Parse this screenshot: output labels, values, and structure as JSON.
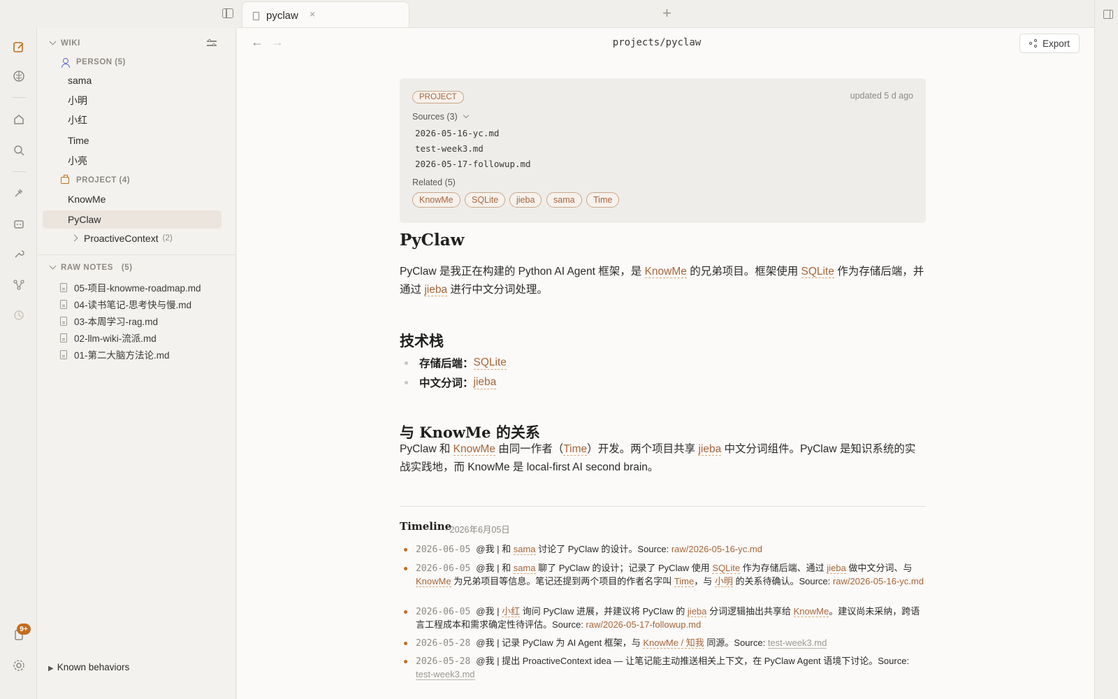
{
  "tab": {
    "title": "pyclaw",
    "close": "×",
    "new": "+"
  },
  "sidebar": {
    "wiki_label": "WIKI",
    "person_header": "PERSON (5)",
    "persons": [
      "sama",
      "小明",
      "小红",
      "Time",
      "小亮"
    ],
    "project_header": "PROJECT (4)",
    "projects": [
      "KnowMe",
      "PyClaw"
    ],
    "proactive": {
      "label": "ProactiveContext",
      "count": "(2)"
    },
    "raw_notes_label": "RAW NOTES",
    "raw_notes_count": "(5)",
    "raw_files": [
      "05-项目-knowme-roadmap.md",
      "04-读书笔记-思考快与慢.md",
      "03-本周学习-rag.md",
      "02-llm-wiki-流派.md",
      "01-第二大脑方法论.md"
    ],
    "known_behaviors": "Known behaviors"
  },
  "rail": {
    "badge": "9+"
  },
  "main": {
    "breadcrumb": "projects/pyclaw",
    "export_label": "Export",
    "meta": {
      "type_pill": "PROJECT",
      "updated": "updated 5 d ago",
      "sources_label": "Sources (3)",
      "sources": [
        "2026-05-16-yc.md",
        "test-week3.md",
        "2026-05-17-followup.md"
      ],
      "related_label": "Related (5)",
      "related": [
        "KnowMe",
        "SQLite",
        "jieba",
        "sama",
        "Time"
      ]
    },
    "title": "PyClaw",
    "intro": {
      "t1": "PyClaw 是我正在构建的 Python AI Agent 框架，是 ",
      "l1": "KnowMe",
      "t2": " 的兄弟项目。框架使用 ",
      "l2": "SQLite",
      "t3": " 作为存储后端，并通过 ",
      "l3": "jieba",
      "t4": " 进行中文分词处理。"
    },
    "tech_heading": "技术栈",
    "tech": [
      {
        "label": "存储后端：",
        "link": "SQLite"
      },
      {
        "label": "中文分词：",
        "link": "jieba"
      }
    ],
    "rel_heading": "与 KnowMe 的关系",
    "rel": {
      "t1": "PyClaw 和 ",
      "l1": "KnowMe",
      "t2": " 由同一作者（",
      "l2": "Time",
      "t3": "）开发。两个项目共享 ",
      "l3": "jieba",
      "t4": " 中文分词组件。PyClaw 是知识系统的实战实践地，而 KnowMe 是 local-first AI second brain。"
    },
    "timeline_heading": "Timeline",
    "timeline_date": "· 2026年6月05日",
    "timeline": {
      "e1": {
        "date": "2026-06-05",
        "t1": "@我 | 和 ",
        "l1": "sama",
        "t2": " 讨论了 PyClaw 的设计。Source: ",
        "src": "raw/2026-05-16-yc.md"
      },
      "e2": {
        "date": "2026-06-05",
        "t1": "@我 | 和 ",
        "l1": "sama",
        "t2": " 聊了 PyClaw 的设计；记录了 PyClaw 使用 ",
        "l2": "SQLite",
        "t3": " 作为存储后端、通过 ",
        "l3": "jieba",
        "t4": " 做中文分词、与 ",
        "l4": "KnowMe",
        "t5": " 为兄弟项目等信息。笔记还提到两个项目的作者名字叫 ",
        "l5": "Time",
        "t6": "，与 ",
        "l6": "小明",
        "t7": " 的关系待确认。Source: ",
        "src": "raw/2026-05-16-yc.md"
      },
      "e3": {
        "date": "2026-06-05",
        "t1": "@我 | ",
        "l1": "小红",
        "t2": " 询问 PyClaw 进展，并建议将 PyClaw 的 ",
        "l2": "jieba",
        "t3": " 分词逻辑抽出共享给 ",
        "l3": "KnowMe",
        "t4": "。建议尚未采纳，跨语言工程成本和需求确定性待评估。Source: ",
        "src": "raw/2026-05-17-followup.md"
      },
      "e4": {
        "date": "2026-05-28",
        "t1": "@我 | 记录 PyClaw 为 AI Agent 框架，与 ",
        "l1": "KnowMe / 知我",
        "t2": " 同源。Source: ",
        "src": "test-week3.md"
      },
      "e5": {
        "date": "2026-05-28",
        "t1": "@我 | 提出 ProactiveContext idea — 让笔记能主动推送相关上下文，在 PyClaw Agent 语境下讨论。Source: ",
        "src": "test-week3.md"
      }
    }
  },
  "colors": {
    "accent": "#c26d1f",
    "link": "#a8653a",
    "active_bg": "#ebe5dd"
  }
}
